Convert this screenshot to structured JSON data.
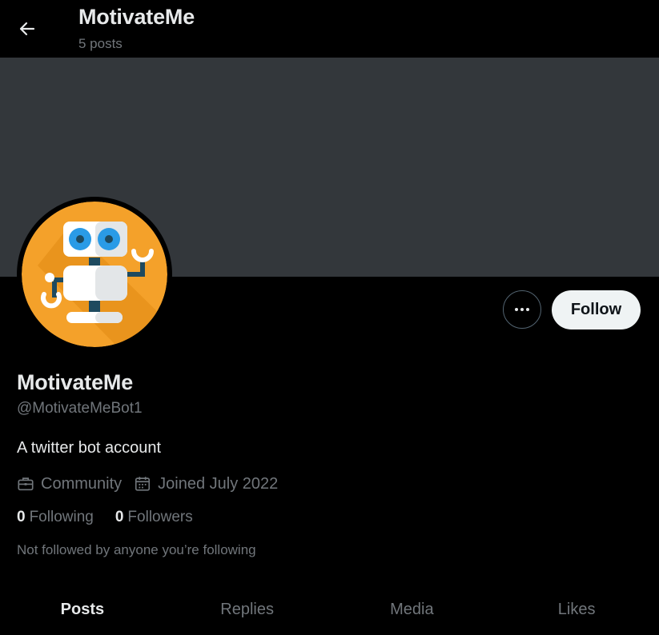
{
  "header": {
    "title": "MotivateMe",
    "post_count": "5 posts"
  },
  "profile": {
    "display_name": "MotivateMe",
    "handle": "@MotivateMeBot1",
    "bio": "A twitter bot account",
    "category": "Community",
    "joined": "Joined July 2022",
    "following_count": "0",
    "following_label": "Following",
    "followers_count": "0",
    "followers_label": "Followers",
    "not_followed_note": "Not followed by anyone you’re following"
  },
  "actions": {
    "follow_label": "Follow"
  },
  "tabs": [
    {
      "label": "Posts",
      "active": true
    },
    {
      "label": "Replies",
      "active": false
    },
    {
      "label": "Media",
      "active": false
    },
    {
      "label": "Likes",
      "active": false
    }
  ],
  "colors": {
    "background": "#000000",
    "banner": "#33373b",
    "avatar_bg": "#f4a12a",
    "primary_text": "#e7e9ea",
    "secondary_text": "#71767b",
    "follow_button_bg": "#eff3f4"
  },
  "icons": {
    "back": "arrow-left-icon",
    "more": "more-horizontal-icon",
    "category": "briefcase-icon",
    "joined": "calendar-icon"
  }
}
